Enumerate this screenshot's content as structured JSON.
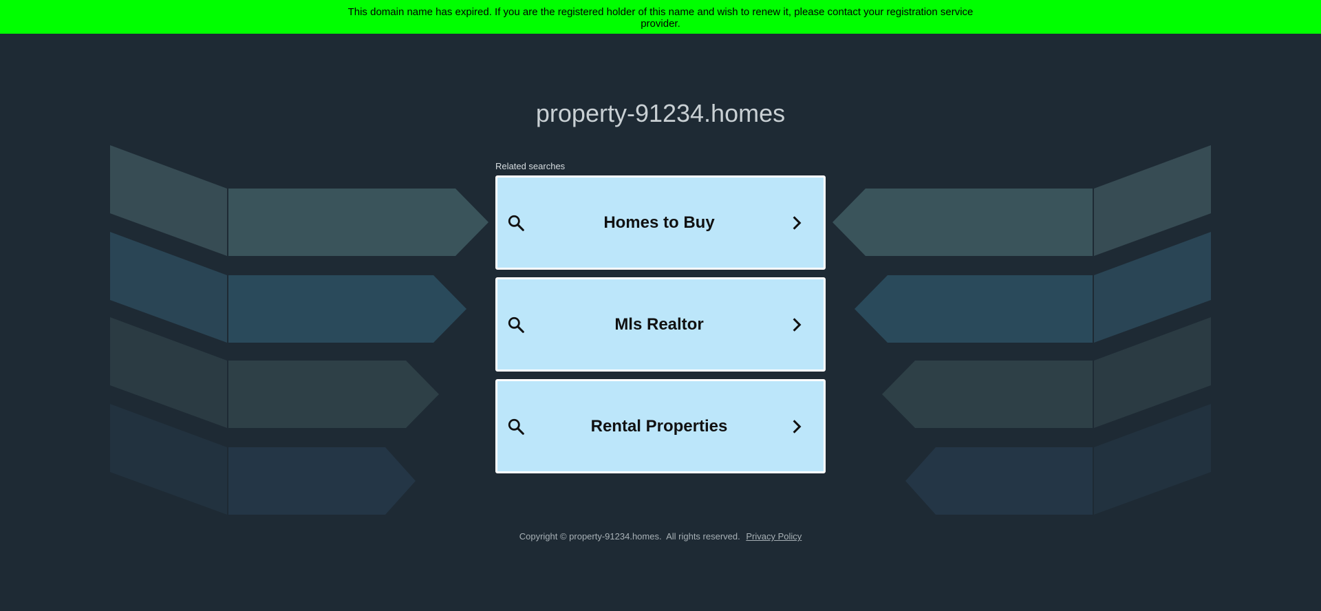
{
  "banner": {
    "text": "This domain name has expired. If you are the registered holder of this name and wish to renew it, please contact your registration service provider."
  },
  "domain": {
    "title": "property-91234.homes"
  },
  "related": {
    "label": "Related searches",
    "items": [
      {
        "label": "Homes to Buy",
        "icon": "search-icon",
        "arrow": "chevron-right-icon"
      },
      {
        "label": "Mls Realtor",
        "icon": "search-icon",
        "arrow": "chevron-right-icon"
      },
      {
        "label": "Rental Properties",
        "icon": "search-icon",
        "arrow": "chevron-right-icon"
      }
    ]
  },
  "footer": {
    "copyright": "Copyright © property-91234.homes.  All rights reserved.",
    "privacy_label": "Privacy Policy"
  },
  "colors": {
    "banner_bg": "#00ff00",
    "page_bg": "#1e2a34",
    "link_bg": "#bce6fa",
    "link_border": "#ffffff"
  }
}
